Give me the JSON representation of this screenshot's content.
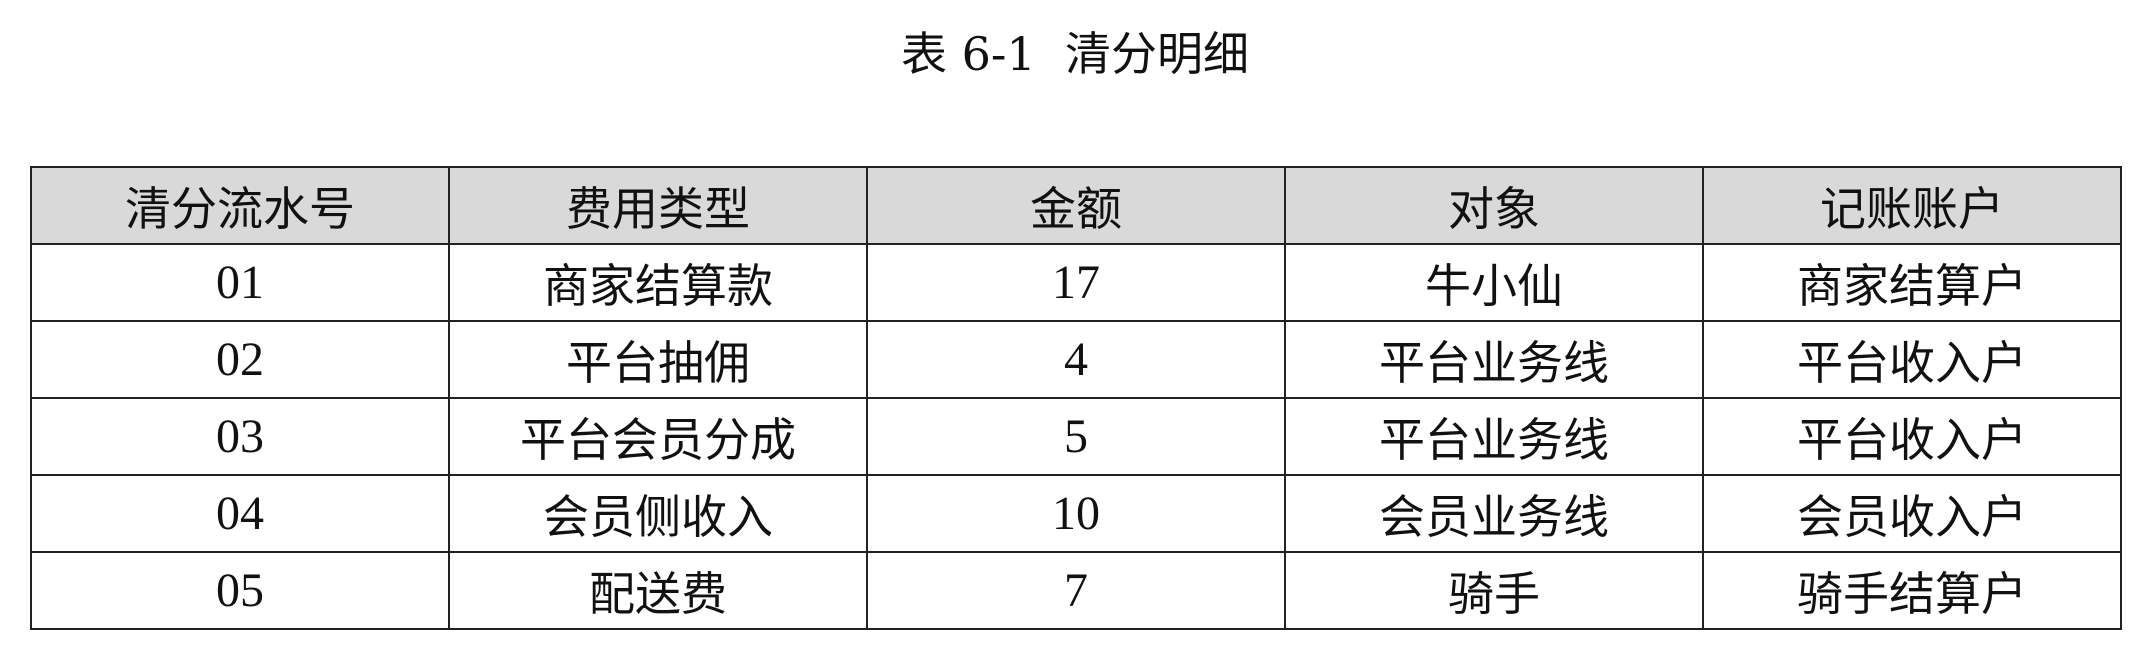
{
  "document": {
    "caption": "表 6-1  清分明细"
  },
  "table": {
    "header_bg": "#d9d9d9",
    "headers": [
      "清分流水号",
      "费用类型",
      "金额",
      "对象",
      "记账账户"
    ],
    "rows": [
      [
        "01",
        "商家结算款",
        "17",
        "牛小仙",
        "商家结算户"
      ],
      [
        "02",
        "平台抽佣",
        "4",
        "平台业务线",
        "平台收入户"
      ],
      [
        "03",
        "平台会员分成",
        "5",
        "平台业务线",
        "平台收入户"
      ],
      [
        "04",
        "会员侧收入",
        "10",
        "会员业务线",
        "会员收入户"
      ],
      [
        "05",
        "配送费",
        "7",
        "骑手",
        "骑手结算户"
      ]
    ]
  }
}
